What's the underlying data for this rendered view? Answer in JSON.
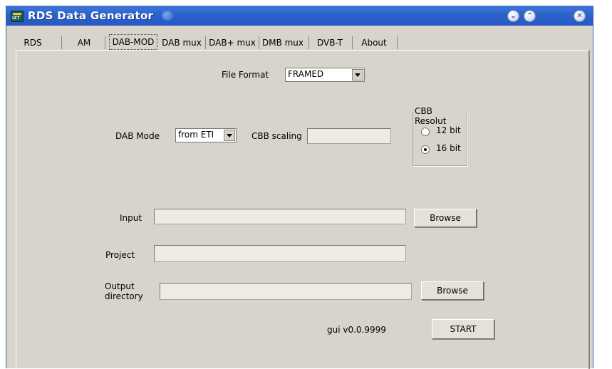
{
  "window": {
    "title": "RDS Data Generator",
    "icon_text": "IZT",
    "controls": [
      "chevron-down",
      "chevron-up",
      "close"
    ]
  },
  "tabs": [
    {
      "label": "RDS",
      "active": false
    },
    {
      "label": "AM",
      "active": false
    },
    {
      "label": "DAB-MOD",
      "active": true
    },
    {
      "label": "DAB mux",
      "active": false
    },
    {
      "label": "DAB+ mux",
      "active": false
    },
    {
      "label": "DMB mux",
      "active": false
    },
    {
      "label": "DVB-T",
      "active": false
    },
    {
      "label": "About",
      "active": false
    }
  ],
  "form": {
    "file_format": {
      "label": "File Format",
      "value": "FRAMED"
    },
    "dab_mode": {
      "label": "DAB Mode",
      "value": "from ETI"
    },
    "cbb_scaling": {
      "label": "CBB scaling",
      "value": ""
    },
    "cbb_resolution": {
      "title": "CBB Resolut",
      "options": [
        {
          "label": "12 bit",
          "selected": false
        },
        {
          "label": "16 bit",
          "selected": true
        }
      ]
    },
    "input": {
      "label": "Input",
      "value": "",
      "browse_label": "Browse"
    },
    "project": {
      "label": "Project",
      "value": ""
    },
    "output_directory": {
      "label_line1": "Output",
      "label_line2": "directory",
      "value": "",
      "browse_label": "Browse"
    },
    "version": "gui v0.0.9999",
    "start_label": "START"
  }
}
